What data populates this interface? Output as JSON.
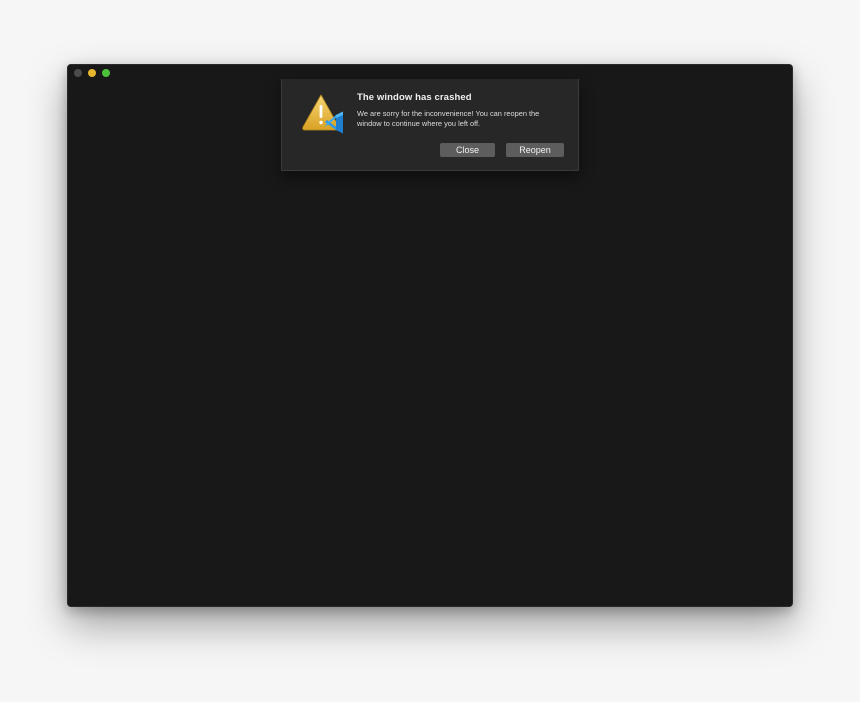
{
  "window": {
    "traffic_lights": [
      {
        "name": "close",
        "color": "#4b4b4b"
      },
      {
        "name": "minimize",
        "color": "#e7b62c"
      },
      {
        "name": "zoom",
        "color": "#4cc23b"
      }
    ]
  },
  "dialog": {
    "icon": "warning-icon-with-vscode-badge",
    "title": "The window has crashed",
    "message": "We are sorry for the inconvenience! You can reopen the window to continue where you left off.",
    "buttons": {
      "close_label": "Close",
      "reopen_label": "Reopen"
    }
  },
  "colors": {
    "window_bg": "#181818",
    "dialog_bg": "#272727",
    "button_bg": "#5d5d5d"
  }
}
